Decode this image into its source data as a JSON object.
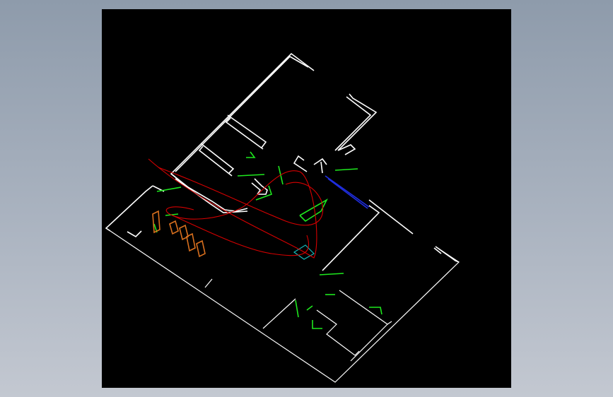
{
  "canvas": {
    "background": "#000000",
    "frame_gradient": [
      "#8e9bab",
      "#c3c8d1"
    ]
  },
  "colors": {
    "walls": "#ffffff",
    "fixtures": "#1ee81e",
    "curve": "#d60000",
    "furniture": "#d9701e",
    "window": "#1f2ee0",
    "marker": "#16b6b6"
  }
}
